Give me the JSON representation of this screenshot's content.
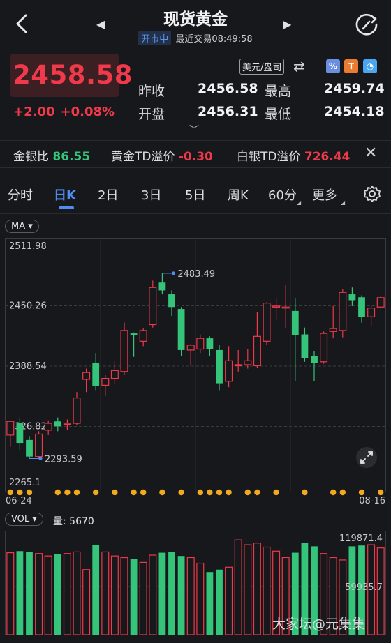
{
  "header": {
    "title": "现货黄金",
    "status_badge": "开市中",
    "last_trade": "最近交易08:49:58"
  },
  "quote": {
    "price": "2458.58",
    "change_abs": "+2.00",
    "change_pct": "+0.08%",
    "prev_close_label": "昨收",
    "prev_close": "2456.58",
    "open_label": "开盘",
    "open": "2456.31",
    "high_label": "最高",
    "high": "2459.74",
    "low_label": "最低",
    "low": "2454.18",
    "currency_unit": "美元/盎司"
  },
  "ratios": {
    "gold_silver_label": "金银比",
    "gold_silver": "86.55",
    "gold_td_label": "黄金TD溢价",
    "gold_td": "-0.30",
    "silver_td_label": "白银TD溢价",
    "silver_td": "726.44"
  },
  "tabs": [
    "分时",
    "日K",
    "2日",
    "3日",
    "5日",
    "周K",
    "60分",
    "更多"
  ],
  "indicator": {
    "ma_label": "MA",
    "vol_label": "VOL",
    "vol_amount": "量: 5670"
  },
  "colors": {
    "up": "#f0394a",
    "down": "#34c47a",
    "accent": "#4f8cf0",
    "marker": "#f3a91c"
  },
  "watermark": "大家坛@元集集",
  "chart_data": {
    "type": "candlestick",
    "y_ticks": [
      "2511.98",
      "2450.26",
      "2388.54",
      "2326.82",
      "2265.1"
    ],
    "ylim": [
      2265.1,
      2511.98
    ],
    "x_labels": [
      "06-24",
      "08-16"
    ],
    "max_label": "2483.49",
    "min_label": "2293.59",
    "candles": [
      {
        "o": 2318,
        "c": 2332,
        "h": 2332,
        "l": 2306
      },
      {
        "o": 2330,
        "c": 2310,
        "h": 2335,
        "l": 2303
      },
      {
        "o": 2313,
        "c": 2296,
        "h": 2317,
        "l": 2294
      },
      {
        "o": 2296,
        "c": 2319,
        "h": 2322,
        "l": 2294
      },
      {
        "o": 2323,
        "c": 2330,
        "h": 2333,
        "l": 2318
      },
      {
        "o": 2332,
        "c": 2327,
        "h": 2336,
        "l": 2322
      },
      {
        "o": 2329,
        "c": 2330,
        "h": 2334,
        "l": 2323
      },
      {
        "o": 2330,
        "c": 2356,
        "h": 2362,
        "l": 2328
      },
      {
        "o": 2375,
        "c": 2382,
        "h": 2386,
        "l": 2362
      },
      {
        "o": 2392,
        "c": 2368,
        "h": 2402,
        "l": 2364
      },
      {
        "o": 2369,
        "c": 2376,
        "h": 2380,
        "l": 2358
      },
      {
        "o": 2376,
        "c": 2384,
        "h": 2394,
        "l": 2370
      },
      {
        "o": 2383,
        "c": 2425,
        "h": 2433,
        "l": 2380
      },
      {
        "o": 2422,
        "c": 2420,
        "h": 2423,
        "l": 2398
      },
      {
        "o": 2414,
        "c": 2425,
        "h": 2427,
        "l": 2409
      },
      {
        "o": 2431,
        "c": 2469,
        "h": 2476,
        "l": 2428
      },
      {
        "o": 2474,
        "c": 2466,
        "h": 2483.49,
        "l": 2462
      },
      {
        "o": 2462,
        "c": 2449,
        "h": 2466,
        "l": 2440
      },
      {
        "o": 2447,
        "c": 2405,
        "h": 2449,
        "l": 2399
      },
      {
        "o": 2405,
        "c": 2410,
        "h": 2411,
        "l": 2389
      },
      {
        "o": 2406,
        "c": 2417,
        "h": 2421,
        "l": 2402
      },
      {
        "o": 2417,
        "c": 2406,
        "h": 2419,
        "l": 2399
      },
      {
        "o": 2405,
        "c": 2371,
        "h": 2410,
        "l": 2364
      },
      {
        "o": 2373,
        "c": 2394,
        "h": 2409,
        "l": 2367
      },
      {
        "o": 2389,
        "c": 2390,
        "h": 2405,
        "l": 2383
      },
      {
        "o": 2390,
        "c": 2394,
        "h": 2406,
        "l": 2386
      },
      {
        "o": 2389,
        "c": 2419,
        "h": 2444,
        "l": 2387
      },
      {
        "o": 2414,
        "c": 2453,
        "h": 2454,
        "l": 2410
      },
      {
        "o": 2450,
        "c": 2450,
        "h": 2458,
        "l": 2436
      },
      {
        "o": 2448,
        "c": 2449,
        "h": 2472,
        "l": 2428
      },
      {
        "o": 2445,
        "c": 2420,
        "h": 2458,
        "l": 2373
      },
      {
        "o": 2421,
        "c": 2397,
        "h": 2428,
        "l": 2393
      },
      {
        "o": 2399,
        "c": 2392,
        "h": 2404,
        "l": 2373
      },
      {
        "o": 2393,
        "c": 2422,
        "h": 2424,
        "l": 2391
      },
      {
        "o": 2424,
        "c": 2427,
        "h": 2450,
        "l": 2417
      },
      {
        "o": 2425,
        "c": 2464,
        "h": 2467,
        "l": 2418
      },
      {
        "o": 2462,
        "c": 2456,
        "h": 2469,
        "l": 2450
      },
      {
        "o": 2459,
        "c": 2439,
        "h": 2461,
        "l": 2433
      },
      {
        "o": 2439,
        "c": 2448,
        "h": 2451,
        "l": 2430
      },
      {
        "o": 2449,
        "c": 2458.58,
        "h": 2459.74,
        "l": 2454.18
      }
    ],
    "volume": {
      "ticks": [
        "119871.4",
        "59935.7"
      ],
      "ylim": [
        0,
        119871.4
      ],
      "values": [
        102000,
        104000,
        103000,
        101000,
        98000,
        100000,
        101000,
        103000,
        81000,
        112000,
        103000,
        98000,
        96000,
        94000,
        90000,
        99000,
        102000,
        103000,
        98000,
        96000,
        89000,
        78000,
        81000,
        84000,
        118000,
        112000,
        114000,
        109000,
        104000,
        96000,
        102000,
        114000,
        110000,
        101000,
        96000,
        93000,
        110000,
        111000,
        112000,
        108000
      ]
    },
    "markers": [
      0,
      1,
      2,
      5,
      6,
      7,
      9,
      11,
      13,
      14,
      16,
      18,
      20,
      21,
      22,
      23,
      25,
      26,
      28,
      31,
      34,
      35,
      37,
      39
    ]
  }
}
